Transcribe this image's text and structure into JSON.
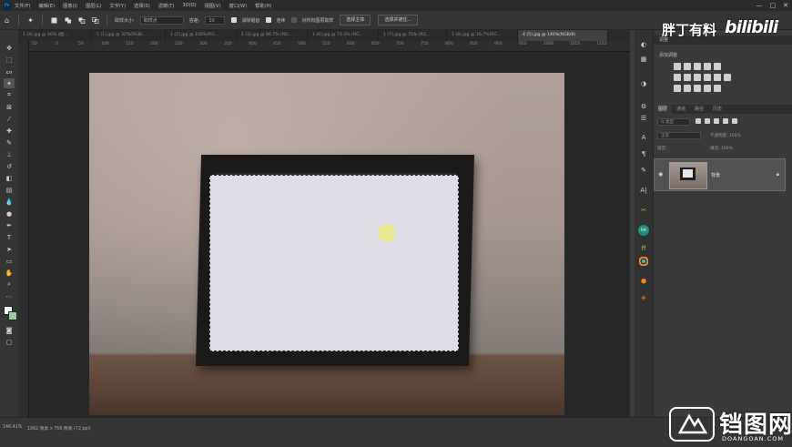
{
  "menubar": {
    "logo": "Ps",
    "items": [
      "文件(F)",
      "编辑(E)",
      "图像(I)",
      "图层(L)",
      "文字(Y)",
      "选择(S)",
      "滤镜(T)",
      "3D(D)",
      "视图(V)",
      "窗口(W)",
      "帮助(H)"
    ],
    "minimize": "—",
    "maximize": "□",
    "close": "✕"
  },
  "options": {
    "home_icon": "⌂",
    "tool_icon": "✦",
    "sample_size_label": "取样大小:",
    "sample_size_value": "取样点",
    "tolerance_label": "容差:",
    "tolerance_value": "10",
    "antialias_label": "消除锯齿",
    "contiguous_label": "连续",
    "sample_all_label": "对所有图层取样",
    "select_subject": "选择主体",
    "select_mask": "选择并遮住..."
  },
  "tabs": [
    {
      "label": "1 (4).jpg @ 40% (图..."
    },
    {
      "label": "1 (1).jpg @ 32%(RGB/..."
    },
    {
      "label": "1 (2).jpg @ 100%(RG..."
    },
    {
      "label": "1 (3).jpg @ 66.7% (RG..."
    },
    {
      "label": "1 (6).jpg @ 73.3% (RG..."
    },
    {
      "label": "1 (7).jpg @ 75% (RG..."
    },
    {
      "label": "1 (8).jpg @ 16.7%(RG..."
    },
    {
      "label": "4 (5).jpg @ 146%(RGB/8)",
      "active": true
    }
  ],
  "ruler_labels": [
    "50",
    "0",
    "50",
    "100",
    "150",
    "200",
    "250",
    "300",
    "350",
    "400",
    "450",
    "500",
    "550",
    "600",
    "650",
    "700",
    "750",
    "800",
    "850",
    "900",
    "950",
    "1000",
    "1050",
    "1100"
  ],
  "status": {
    "zoom": "146.41%",
    "doc_info": "1062 像素 x 766 像素 (72 ppi)"
  },
  "panels": {
    "adjustments_title": "调整",
    "adjustments_subtitle": "添加调整",
    "layers_tabs": [
      "图层",
      "通道",
      "路径",
      "历史"
    ],
    "kind_label": "Q 类型",
    "blend_mode": "正常",
    "opacity_label": "不透明度: 100%",
    "lock_label": "锁定:",
    "fill_label": "填充: 100%",
    "layer_name": "背景"
  },
  "overlay": {
    "author": "胖丁有料",
    "bili": "bilibili",
    "brand": "铛图网",
    "url": "DOANGOAN.COM"
  }
}
